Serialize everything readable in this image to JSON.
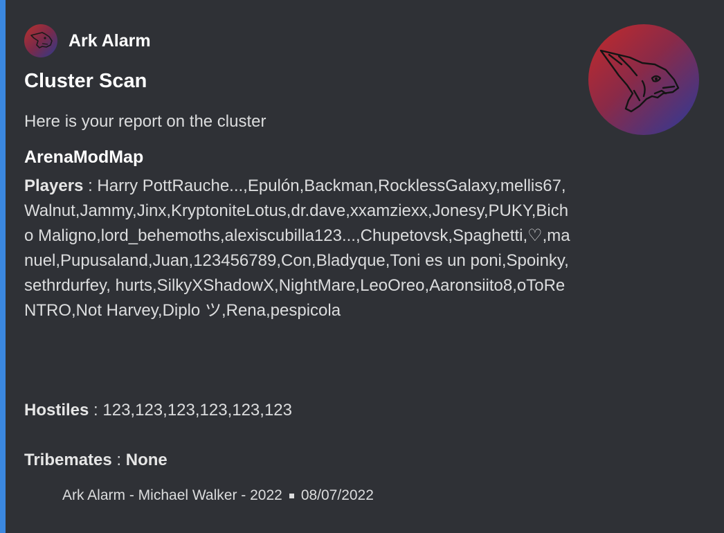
{
  "embed": {
    "accent_color": "#3b88e0",
    "author": {
      "name": "Ark Alarm"
    },
    "title": "Cluster Scan",
    "description": "Here is your report on the cluster",
    "map_name": "ArenaModMap",
    "players": {
      "label": "Players",
      "separator": " : ",
      "value": "Harry PottRauche...,Epulón,Backman,RocklessGalaxy,mellis67,Walnut,Jammy,Jinx,KryptoniteLotus,dr.dave,xxamziexx,Jonesy,PUKY,Bicho Maligno,lord_behemoths,alexiscubilla123...,Chupetovsk,Spaghetti,♡,manuel,Pupusaland,Juan,123456789,Con,Bladyque,Toni es un poni,Spoinky,sethrdurfey, hurts,SilkyXShadowX,NightMare,LeoOreo,Aaronsiito8,oToReNTRO,Not Harvey,Diplo ツ,Rena,pespicola"
    },
    "hostiles": {
      "label": "Hostiles",
      "separator": " : ",
      "value": "123,123,123,123,123,123"
    },
    "tribemates": {
      "label": "Tribemates",
      "separator": " : ",
      "value": "None"
    },
    "footer": {
      "text": "Ark Alarm - Michael Walker - 2022",
      "date": "08/07/2022"
    }
  }
}
